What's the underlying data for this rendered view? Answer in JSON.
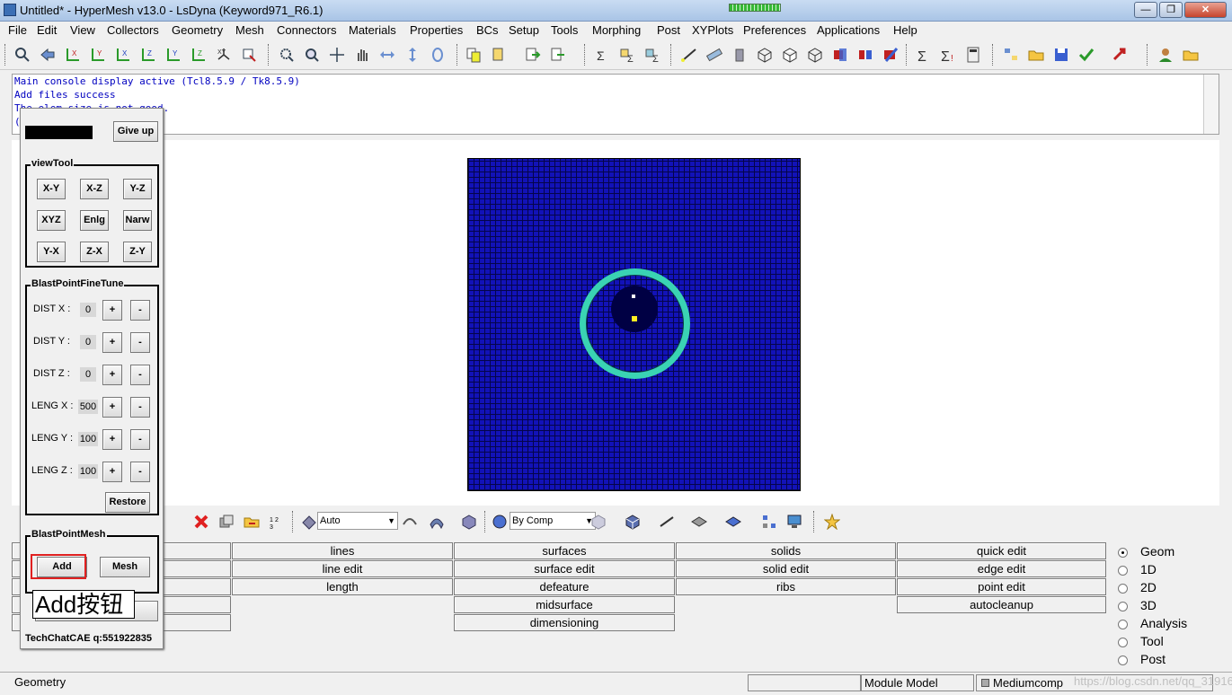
{
  "window": {
    "title": "Untitled* - HyperMesh v13.0 - LsDyna (Keyword971_R6.1)",
    "minimize": "—",
    "maximize": "❐",
    "close": "✕"
  },
  "menu": [
    "File",
    "Edit",
    "View",
    "Collectors",
    "Geometry",
    "Mesh",
    "Connectors",
    "Materials",
    "Properties",
    "BCs",
    "Setup",
    "Tools",
    "Morphing",
    "Post",
    "XYPlots",
    "Preferences",
    "Applications",
    "Help"
  ],
  "console": {
    "lines": [
      "Main console display active (Tcl8.5.9 / Tk8.5.9)",
      "Add files success",
      "The elem size is not good.",
      "("
    ]
  },
  "bottom_toolbar": {
    "auto_label": "Auto",
    "bycomp_label": "By Comp"
  },
  "panel_grid": {
    "col0": [
      "",
      "",
      "",
      "",
      ""
    ],
    "col1": [
      "lines",
      "line edit",
      "length"
    ],
    "col2": [
      "surfaces",
      "surface edit",
      "defeature",
      "midsurface",
      "dimensioning"
    ],
    "col3": [
      "solids",
      "solid edit",
      "ribs"
    ],
    "col4": [
      "quick edit",
      "edge edit",
      "point edit",
      "autocleanup"
    ]
  },
  "page_radios": {
    "items": [
      "Geom",
      "1D",
      "2D",
      "3D",
      "Analysis",
      "Tool",
      "Post"
    ],
    "selected": "Geom"
  },
  "status": {
    "left": "Geometry",
    "module": "Module Model",
    "comp": "Mediumcomp",
    "watermark": "https://blog.csdn.net/qq_31916049"
  },
  "tool_panel": {
    "give_up": "Give up",
    "viewtool_title": "viewTool",
    "view_buttons": [
      "X-Y",
      "X-Z",
      "Y-Z",
      "XYZ",
      "Enlg",
      "Narw",
      "Y-X",
      "Z-X",
      "Z-Y"
    ],
    "finetune_title": "BlastPointFineTune",
    "fields": [
      {
        "label": "DIST X :",
        "value": "0"
      },
      {
        "label": "DIST Y :",
        "value": "0"
      },
      {
        "label": "DIST Z :",
        "value": "0"
      },
      {
        "label": "LENG X :",
        "value": "500"
      },
      {
        "label": "LENG Y :",
        "value": "100"
      },
      {
        "label": "LENG Z :",
        "value": "100"
      }
    ],
    "plus": "+",
    "minus": "-",
    "restore": "Restore",
    "mesh_title": "BlastPointMesh",
    "add": "Add",
    "mesh": "Mesh",
    "credit": "TechChatCAE q:551922835"
  },
  "callout": "Add按钮",
  "colors": {
    "mesh_fill": "#1212b8",
    "ring": "#3ad3b3",
    "console_text": "#0000c0",
    "highlight": "#e02020"
  }
}
